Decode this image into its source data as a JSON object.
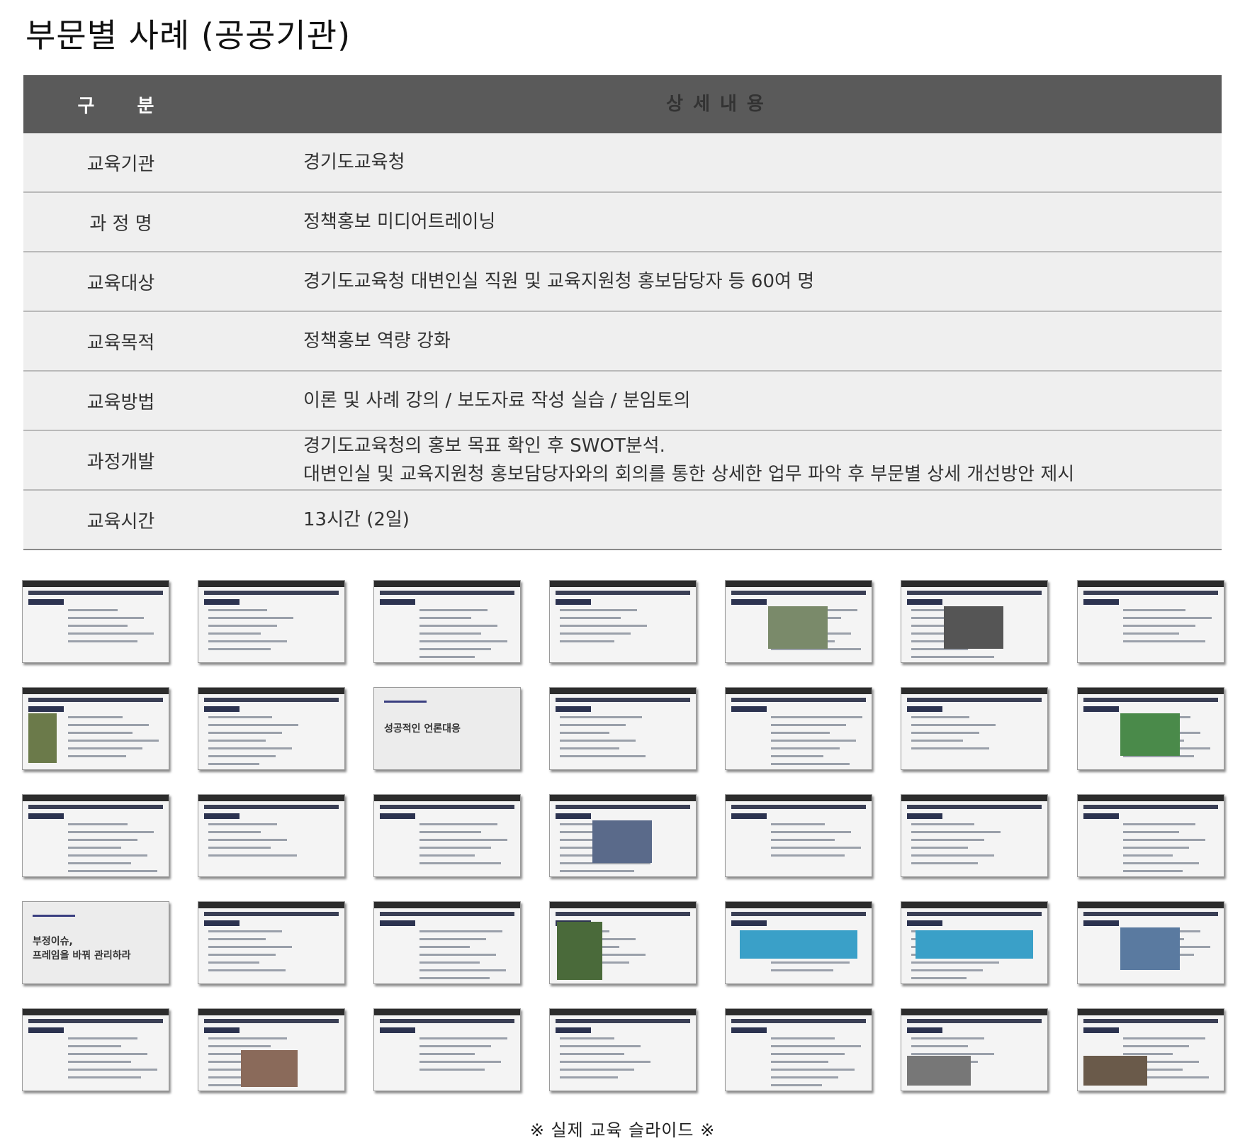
{
  "page_title": "부문별 사례 (공공기관)",
  "table": {
    "header": {
      "col1": "구  분",
      "col2": "상세내용"
    },
    "rows": [
      {
        "label": "교육기관",
        "lines": [
          "경기도교육청"
        ]
      },
      {
        "label": "과 정 명",
        "lines": [
          "정책홍보 미디어트레이닝"
        ]
      },
      {
        "label": "교육대상",
        "lines": [
          "경기도교육청 대변인실 직원 및 교육지원청 홍보담당자 등 60여 명"
        ]
      },
      {
        "label": "교육목적",
        "lines": [
          "정책홍보 역량 강화"
        ]
      },
      {
        "label": "교육방법",
        "lines": [
          "이론 및 사례 강의 / 보도자료 작성 실습 / 분임토의"
        ]
      },
      {
        "label": "과정개발",
        "lines": [
          "경기도교육청의 홍보 목표 확인 후 SWOT분석.",
          "대변인실 및 교육지원청 홍보담당자와의 회의를 통한 상세한 업무 파악 후 부문별 상세 개선방안 제시"
        ]
      },
      {
        "label": "교육시간",
        "lines": [
          "13시간 (2일)"
        ]
      }
    ]
  },
  "slides": {
    "special_titles": {
      "r2c3": "성공적인 언론대응",
      "r4c1": "부정이슈,\n프레임을 바꿔 관리하라"
    }
  },
  "caption": "※ 실제 교육 슬라이드 ※"
}
